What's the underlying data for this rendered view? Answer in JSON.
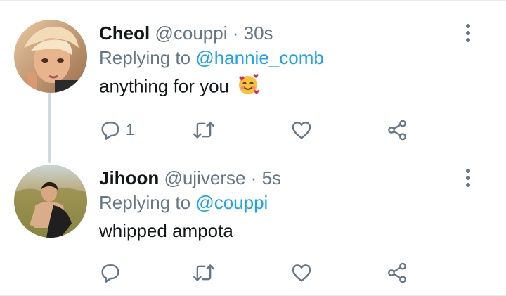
{
  "tweets": [
    {
      "name": "Cheol",
      "handle": "@couppi",
      "separator": "·",
      "time": "30s",
      "replying_prefix": "Replying to",
      "replying_to": "@hannie_comb",
      "text": "anything for you",
      "emoji": "smiling-face-with-hearts",
      "reply_count": "1"
    },
    {
      "name": "Jihoon",
      "handle": "@ujiverse",
      "separator": "·",
      "time": "5s",
      "replying_prefix": "Replying to",
      "replying_to": "@couppi",
      "text": "whipped ampota",
      "reply_count": ""
    }
  ],
  "colors": {
    "link": "#1da1f2",
    "secondary_text": "#657786",
    "primary_text": "#14171a",
    "thread_line": "#cfd9de"
  },
  "icons": [
    "reply-icon",
    "retweet-icon",
    "like-icon",
    "share-icon",
    "more-options-icon"
  ]
}
